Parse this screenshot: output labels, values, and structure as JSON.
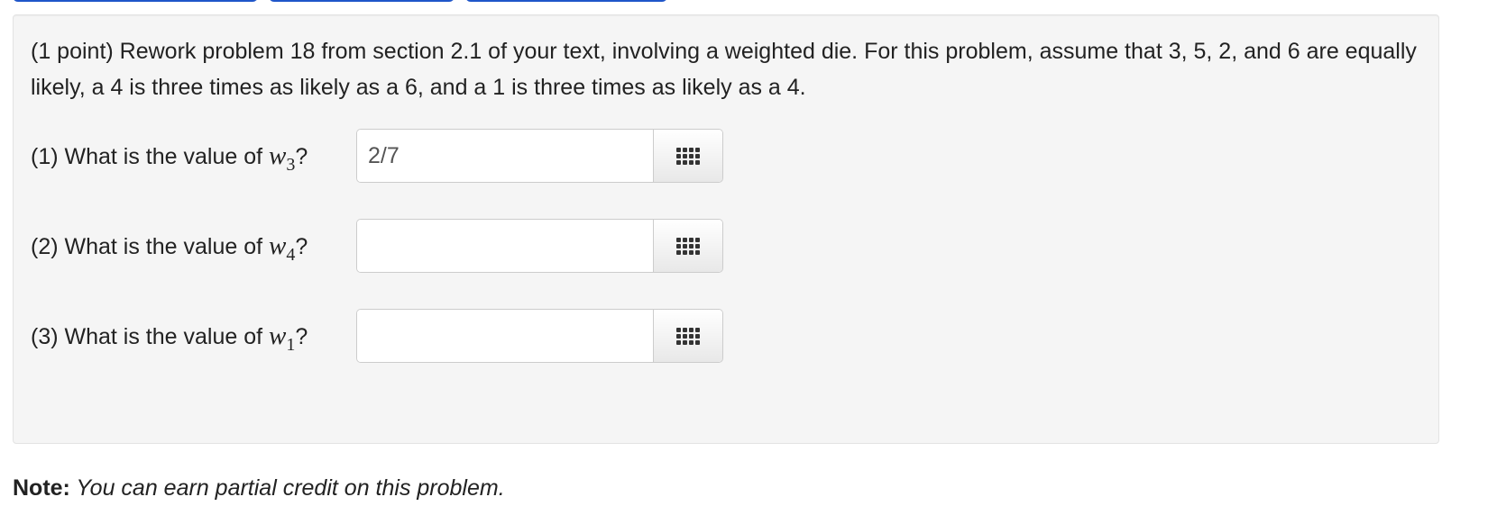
{
  "problem": {
    "statement": "(1 point) Rework problem 18 from section 2.1 of your text, involving a weighted die. For this problem, assume that 3, 5, 2, and 6 are equally likely, a 4 is three times as likely as a 6, and a 1 is three times as likely as a 4.",
    "questions": [
      {
        "prefix": "(1) What is the value of ",
        "var": "w",
        "sub": "3",
        "suffix": "?",
        "value": "2/7",
        "palette_icon": "grid-icon"
      },
      {
        "prefix": "(2) What is the value of ",
        "var": "w",
        "sub": "4",
        "suffix": "?",
        "value": "",
        "palette_icon": "grid-icon"
      },
      {
        "prefix": "(3) What is the value of ",
        "var": "w",
        "sub": "1",
        "suffix": "?",
        "value": "",
        "palette_icon": "grid-icon"
      }
    ]
  },
  "note": {
    "label": "Note:",
    "text": " You can earn partial credit on this problem."
  },
  "colors": {
    "well_background": "#f5f5f5",
    "tab_border": "#1f56c9",
    "text": "#222222"
  }
}
